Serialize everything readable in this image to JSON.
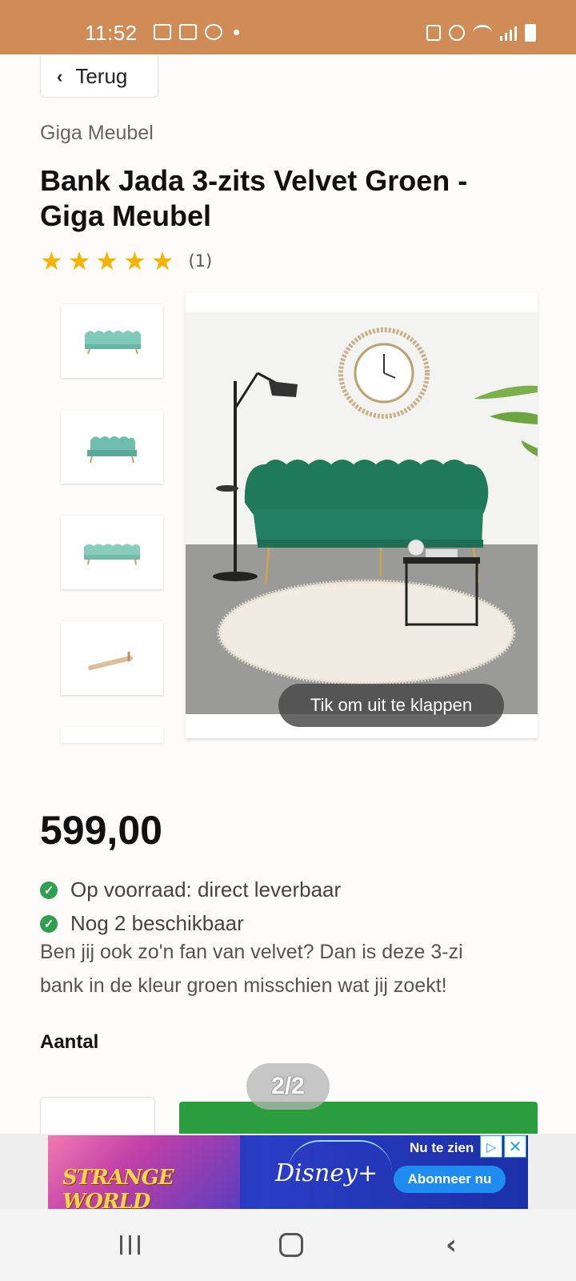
{
  "status_bar": {
    "time": "11:52",
    "background_color": "#cf8c57"
  },
  "header": {
    "back_label": "Terug"
  },
  "product": {
    "brand": "Giga Meubel",
    "title_line1": "Bank Jada 3-zits Velvet Groen -",
    "title_line2": "Giga Meubel",
    "rating_stars": 5,
    "rating_count": "(1)",
    "expand_hint": "Tik om uit te klappen",
    "price": "599,00",
    "stock_status": "Op voorraad: direct leverbaar",
    "availability": "Nog 2 beschikbaar",
    "description_line1": "Ben jij ook zo'n fan van velvet? Dan is deze 3-zi",
    "description_line2": "bank in de kleur groen misschien wat jij zoekt!",
    "quantity_label": "Aantal",
    "accent_color": "#2a9d3e"
  },
  "image_gallery": {
    "page_indicator": "2/2",
    "thumbnail_icons": [
      "sofa-front-icon",
      "sofa-angle-icon",
      "sofa-front-icon",
      "sofa-leg-icon"
    ]
  },
  "ad": {
    "movie_title": "STRANGE WORLD",
    "brand": "Disney+",
    "tagline": "Nu te zien",
    "cta": "Abonneer nu"
  }
}
